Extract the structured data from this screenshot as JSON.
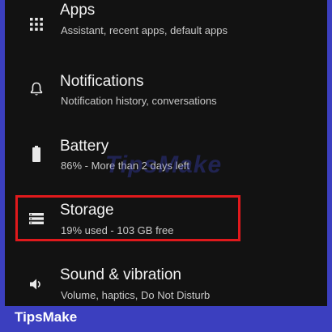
{
  "settings": {
    "items": [
      {
        "title": "Apps",
        "subtitle": "Assistant, recent apps, default apps",
        "icon": "apps-grid-icon"
      },
      {
        "title": "Notifications",
        "subtitle": "Notification history, conversations",
        "icon": "bell-icon"
      },
      {
        "title": "Battery",
        "subtitle": "86% - More than 2 days left",
        "icon": "battery-icon"
      },
      {
        "title": "Storage",
        "subtitle": "19% used - 103 GB free",
        "icon": "storage-icon"
      },
      {
        "title": "Sound & vibration",
        "subtitle": "Volume, haptics, Do Not Disturb",
        "icon": "speaker-icon"
      }
    ]
  },
  "watermark": "TipsMake",
  "footer": {
    "brand": "TipsMake"
  },
  "colors": {
    "frame": "#3b3fbf",
    "background": "#121212",
    "highlight": "#e0191c",
    "title_text": "#f2f2f2",
    "subtitle_text": "#c9c9c9"
  }
}
